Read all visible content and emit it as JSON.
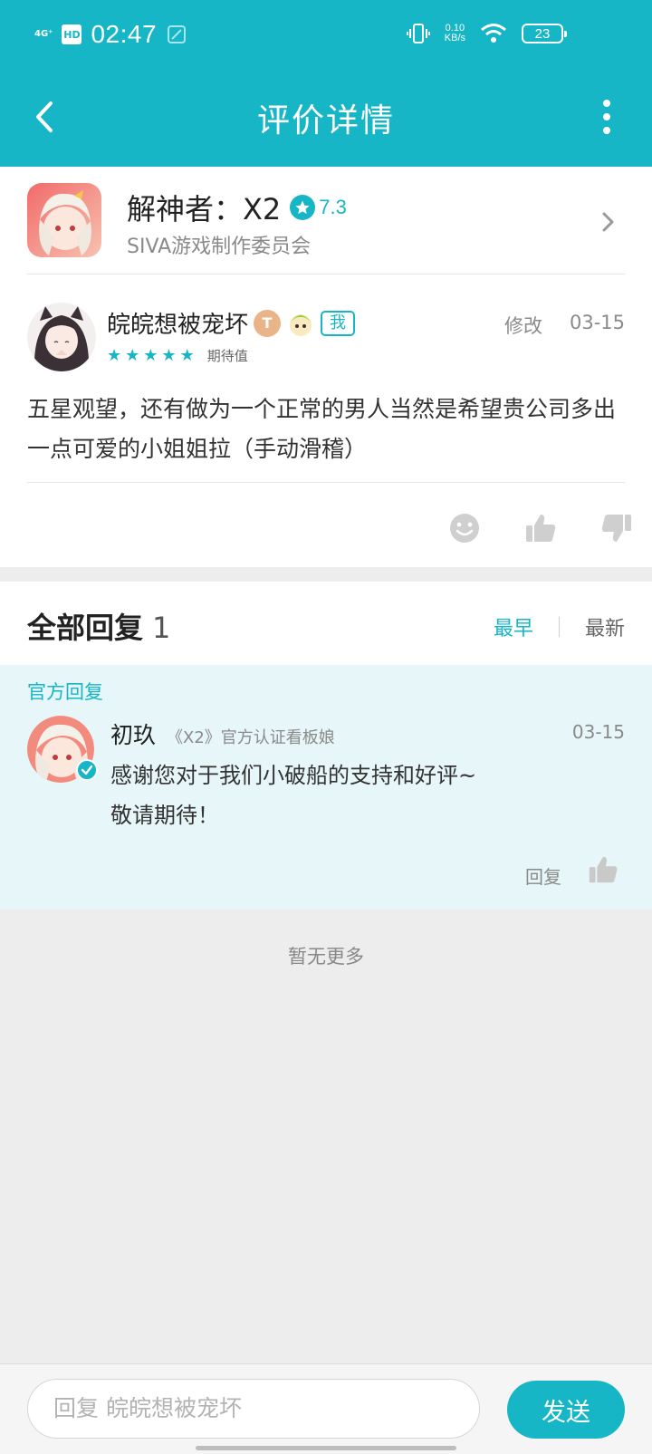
{
  "status_bar": {
    "signal": "4G⁺",
    "hd": "HD",
    "time": "02:47",
    "net_speed_value": "0.10",
    "net_speed_unit": "KB/s",
    "battery": "23"
  },
  "nav": {
    "title": "评价详情"
  },
  "game": {
    "name": "解神者：X2",
    "rating": "7.3",
    "developer": "SIVA游戏制作委员会"
  },
  "review": {
    "user_name": "皖皖想被宠坏",
    "medal": "T",
    "me_badge": "我",
    "stars": 5,
    "star_label": "期待值",
    "edit_label": "修改",
    "date": "03-15",
    "body": "五星观望，还有做为一个正常的男人当然是希望贵公司多出一点可爱的小姐姐拉（手动滑稽）"
  },
  "replies": {
    "title": "全部回复",
    "count": "1",
    "sort_early": "最早",
    "sort_new": "最新"
  },
  "official_reply": {
    "label": "官方回复",
    "name": "初玖",
    "title": "《X2》官方认证看板娘",
    "date": "03-15",
    "line1": "感谢您对于我们小破船的支持和好评~",
    "line2": "敬请期待！",
    "reply_label": "回复"
  },
  "footer": {
    "no_more": "暂无更多"
  },
  "composer": {
    "placeholder": "回复 皖皖想被宠坏",
    "send_label": "发送"
  },
  "colors": {
    "accent": "#16b6c6",
    "official_bg": "#e6f6f9",
    "page_bg": "#ededed"
  }
}
